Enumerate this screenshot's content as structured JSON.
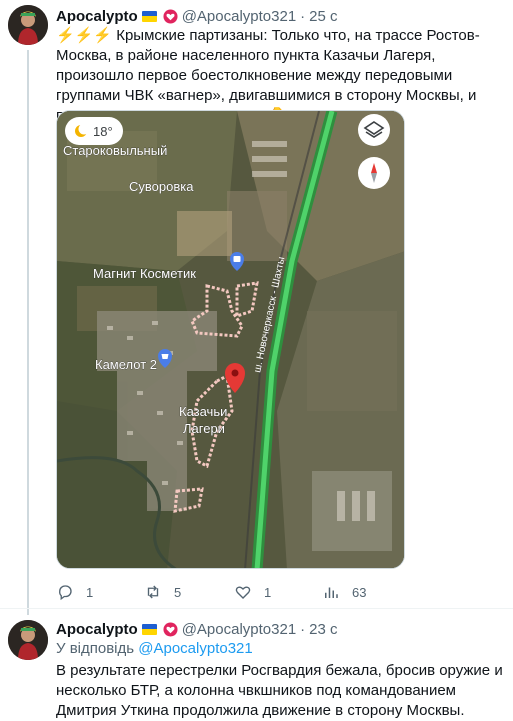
{
  "tweet1": {
    "name": "Apocalypto",
    "handle": "@Apocalypto321",
    "sep": "·",
    "time": "25 с",
    "lead_icons": "⚡⚡⚡",
    "text": "Крымские партизаны: Только что, на трассе Ростов-Москва, в районе населенного пункта Казачьи Лагеря, произошло первое боестолкновение между передовыми группами ЧВК «вагнер», двигавшимися в сторону Москвы, и подразделениями Росгвардии.",
    "trailing": "👇...",
    "map": {
      "weather_temp": "18°",
      "labels": {
        "starokovylny": "Староковыльный",
        "suvorovka": "Суворовка",
        "magnit": "Магнит Косметик",
        "kamelot": "Камелот 2",
        "kazachi": "Казачьи",
        "lageri": "Лагери",
        "road": "ш. Новочеркасск - Шахты"
      }
    },
    "actions": {
      "replies": "1",
      "retweets": "5",
      "likes": "1",
      "views": "63"
    }
  },
  "tweet2": {
    "name": "Apocalypto",
    "handle": "@Apocalypto321",
    "sep": "·",
    "time": "23 с",
    "reply_prefix": "У відповідь",
    "reply_handle": "@Apocalypto321",
    "text": "В результате перестрелки Росгвардия бежала, бросив оружие и несколько БТР, а колонна чвкшников под командованием Дмитрия Уткина продолжила движение в сторону Москвы."
  },
  "colors": {
    "flag_top": "#1f5fd1",
    "flag_bottom": "#ffd500",
    "link": "#1d9bf0",
    "muted": "#536471"
  }
}
